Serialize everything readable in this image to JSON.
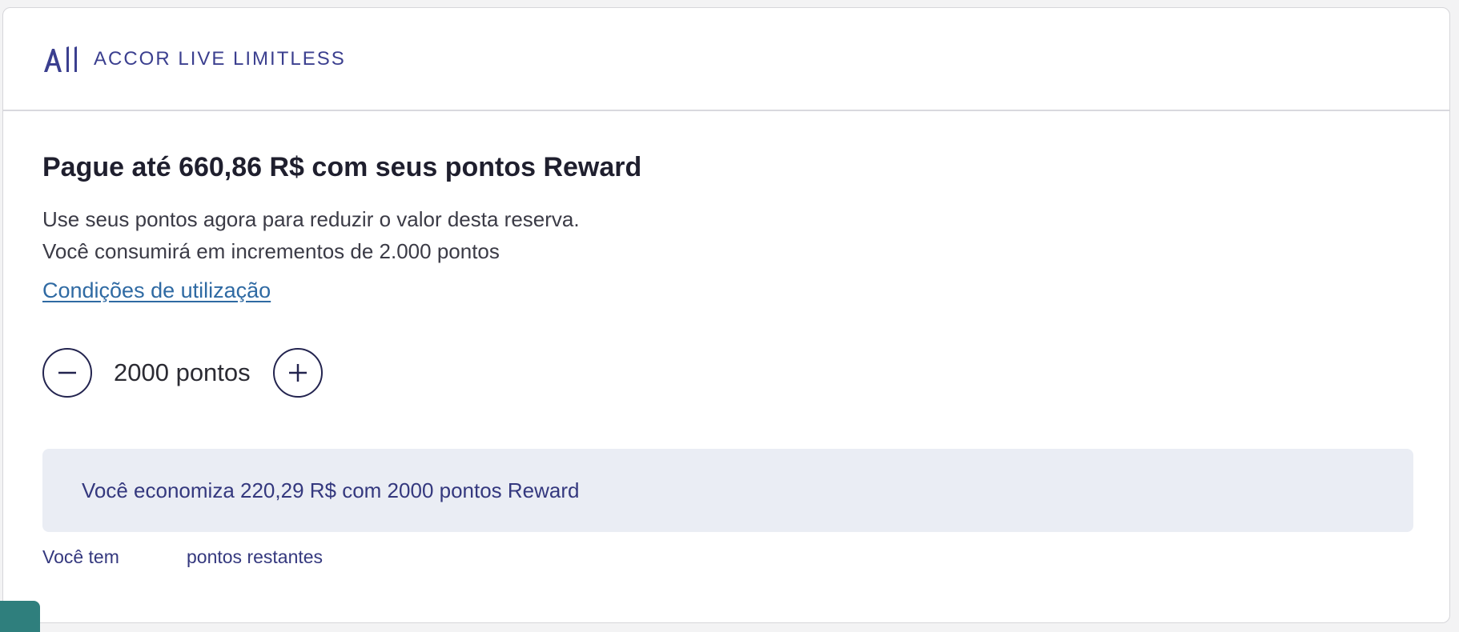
{
  "header": {
    "brand_text": "ACCOR LIVE LIMITLESS",
    "brand_mark": "All",
    "brand_color": "#3b3f8f"
  },
  "rewards": {
    "title": "Pague até 660,86 R$ com seus pontos Reward",
    "description_line1": "Use seus pontos agora para reduzir o valor desta reserva.",
    "description_line2": "Você consumirá em incrementos de 2.000 pontos",
    "conditions_link": "Condições de utilização",
    "stepper": {
      "value_label": "2000 pontos",
      "decrement_icon": "minus-icon",
      "increment_icon": "plus-icon"
    },
    "savings_text": "Você economiza 220,29 R$ com 2000 pontos Reward",
    "remaining_prefix": "Você tem",
    "remaining_suffix": "pontos restantes"
  },
  "colors": {
    "accent": "#3b3f8f",
    "link": "#2f6aa3",
    "savings_bg": "#eaedf4",
    "chat_tab": "#2f7f7d"
  }
}
